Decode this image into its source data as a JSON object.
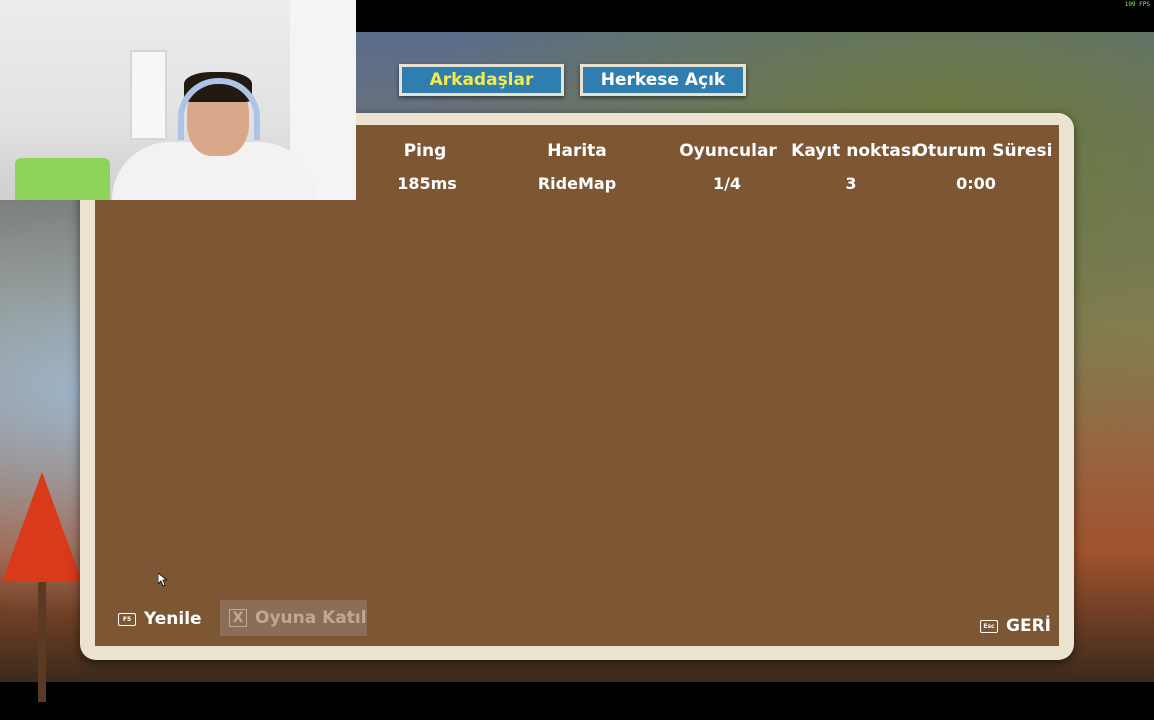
{
  "overlay": {
    "fps": "109 FPS"
  },
  "tabs": [
    {
      "label": "Arkadaşlar",
      "active": true
    },
    {
      "label": "Herkese Açık",
      "active": false
    }
  ],
  "table": {
    "headers": [
      "Ping",
      "Harita",
      "Oyuncular",
      "Kayıt noktası",
      "Oturum Süresi"
    ],
    "rows": [
      [
        "185ms",
        "RideMap",
        "1/4",
        "3",
        "0:00"
      ]
    ]
  },
  "footer": {
    "refresh_key": "F5",
    "refresh_label": "Yenile",
    "join_key": "X",
    "join_label": "Oyuna Katıl",
    "back_key": "Esc",
    "back_label": "GERİ"
  },
  "colors": {
    "tab_blue": "#2e7fb0",
    "active_tab_text": "#f6e94a",
    "panel_frame": "#ebe3cf",
    "panel_fill": "#7d5634"
  }
}
